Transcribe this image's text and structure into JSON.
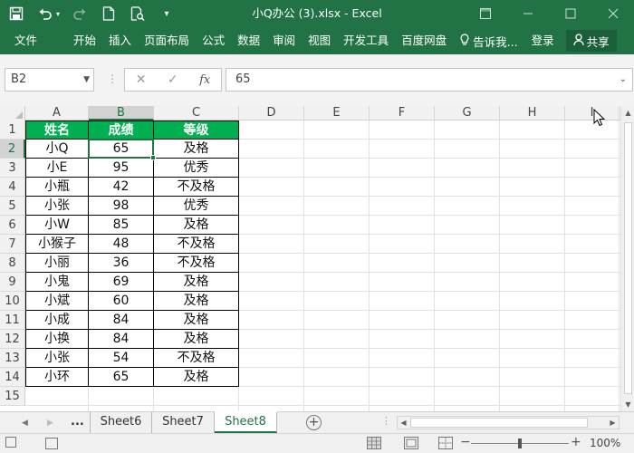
{
  "titlebar": {
    "title": "小Q办公 (3).xlsx - Excel"
  },
  "ribbon": {
    "tabs": [
      "文件",
      "开始",
      "插入",
      "页面布局",
      "公式",
      "数据",
      "审阅",
      "视图",
      "开发工具",
      "百度网盘"
    ],
    "tell_me": "告诉我...",
    "login": "登录",
    "share": "共享"
  },
  "formula_bar": {
    "name_box": "B2",
    "formula": "65"
  },
  "grid": {
    "columns": [
      "A",
      "B",
      "C",
      "D",
      "E",
      "F",
      "G",
      "H",
      "I"
    ],
    "rows": [
      "1",
      "2",
      "3",
      "4",
      "5",
      "6",
      "7",
      "8",
      "9",
      "10",
      "11",
      "12",
      "13",
      "14",
      "15"
    ],
    "header": [
      "姓名",
      "成绩",
      "等级"
    ],
    "data": [
      [
        "小Q",
        "65",
        "及格"
      ],
      [
        "小E",
        "95",
        "优秀"
      ],
      [
        "小瓶",
        "42",
        "不及格"
      ],
      [
        "小张",
        "98",
        "优秀"
      ],
      [
        "小W",
        "85",
        "及格"
      ],
      [
        "小猴子",
        "48",
        "不及格"
      ],
      [
        "小丽",
        "36",
        "不及格"
      ],
      [
        "小鬼",
        "69",
        "及格"
      ],
      [
        "小斌",
        "60",
        "及格"
      ],
      [
        "小成",
        "84",
        "及格"
      ],
      [
        "小换",
        "84",
        "及格"
      ],
      [
        "小张",
        "54",
        "不及格"
      ],
      [
        "小环",
        "65",
        "及格"
      ]
    ],
    "header_color": "#00B050"
  },
  "sheets": {
    "tabs": [
      "Sheet6",
      "Sheet7",
      "Sheet8"
    ],
    "active": "Sheet8",
    "more": "..."
  },
  "statusbar": {
    "zoom": "100%"
  },
  "colors": {
    "accent": "#217346"
  }
}
